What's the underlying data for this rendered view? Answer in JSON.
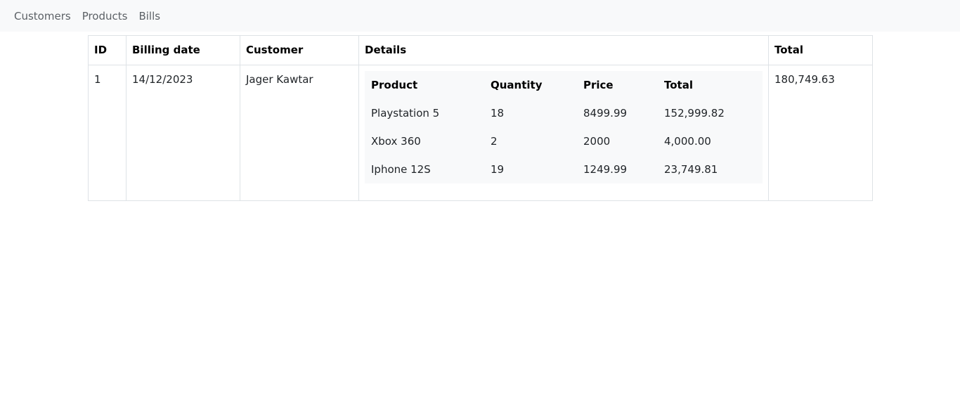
{
  "nav": {
    "items": [
      {
        "label": "Customers"
      },
      {
        "label": "Products"
      },
      {
        "label": "Bills"
      }
    ]
  },
  "bills_table": {
    "headers": {
      "id": "ID",
      "billing_date": "Billing date",
      "customer": "Customer",
      "details": "Details",
      "total": "Total"
    },
    "rows": [
      {
        "id": "1",
        "billing_date": "14/12/2023",
        "customer": "Jager Kawtar",
        "total": "180,749.63",
        "details": {
          "headers": {
            "product": "Product",
            "quantity": "Quantity",
            "price": "Price",
            "total": "Total"
          },
          "items": [
            {
              "product": "Playstation 5",
              "quantity": "18",
              "price": "8499.99",
              "total": "152,999.82"
            },
            {
              "product": "Xbox 360",
              "quantity": "2",
              "price": "2000",
              "total": "4,000.00"
            },
            {
              "product": "Iphone 12S",
              "quantity": "19",
              "price": "1249.99",
              "total": "23,749.81"
            }
          ]
        }
      }
    ]
  }
}
